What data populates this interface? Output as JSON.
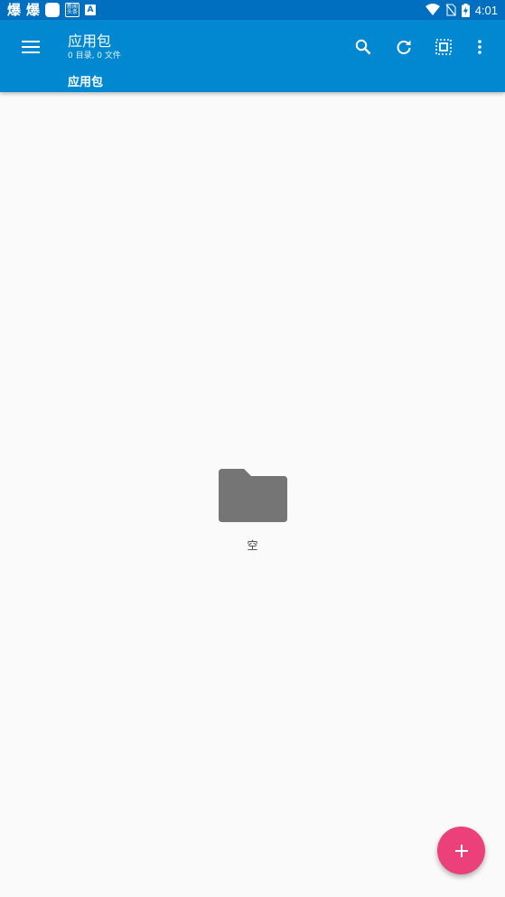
{
  "status_bar": {
    "time": "4:01",
    "left_glyph_1": "爆",
    "left_glyph_2": "爆",
    "badge_text": "新闻 头条",
    "a_glyph": "A",
    "icons": [
      "app-icon",
      "app-icon",
      "white-square-icon",
      "news-app-icon",
      "a-app-icon",
      "wifi-icon",
      "no-sim-icon",
      "battery-charging-icon"
    ]
  },
  "app_bar": {
    "color": "#0288d1",
    "title": "应用包",
    "subtitle": "0 目录, 0 文件",
    "breadcrumb": "应用包",
    "actions": [
      "menu-icon",
      "search-icon",
      "refresh-icon",
      "select-all-icon",
      "more-vert-icon"
    ]
  },
  "empty_state": {
    "icon": "folder-icon",
    "label": "空"
  },
  "fab": {
    "icon": "plus-icon",
    "color": "#ec407a"
  }
}
